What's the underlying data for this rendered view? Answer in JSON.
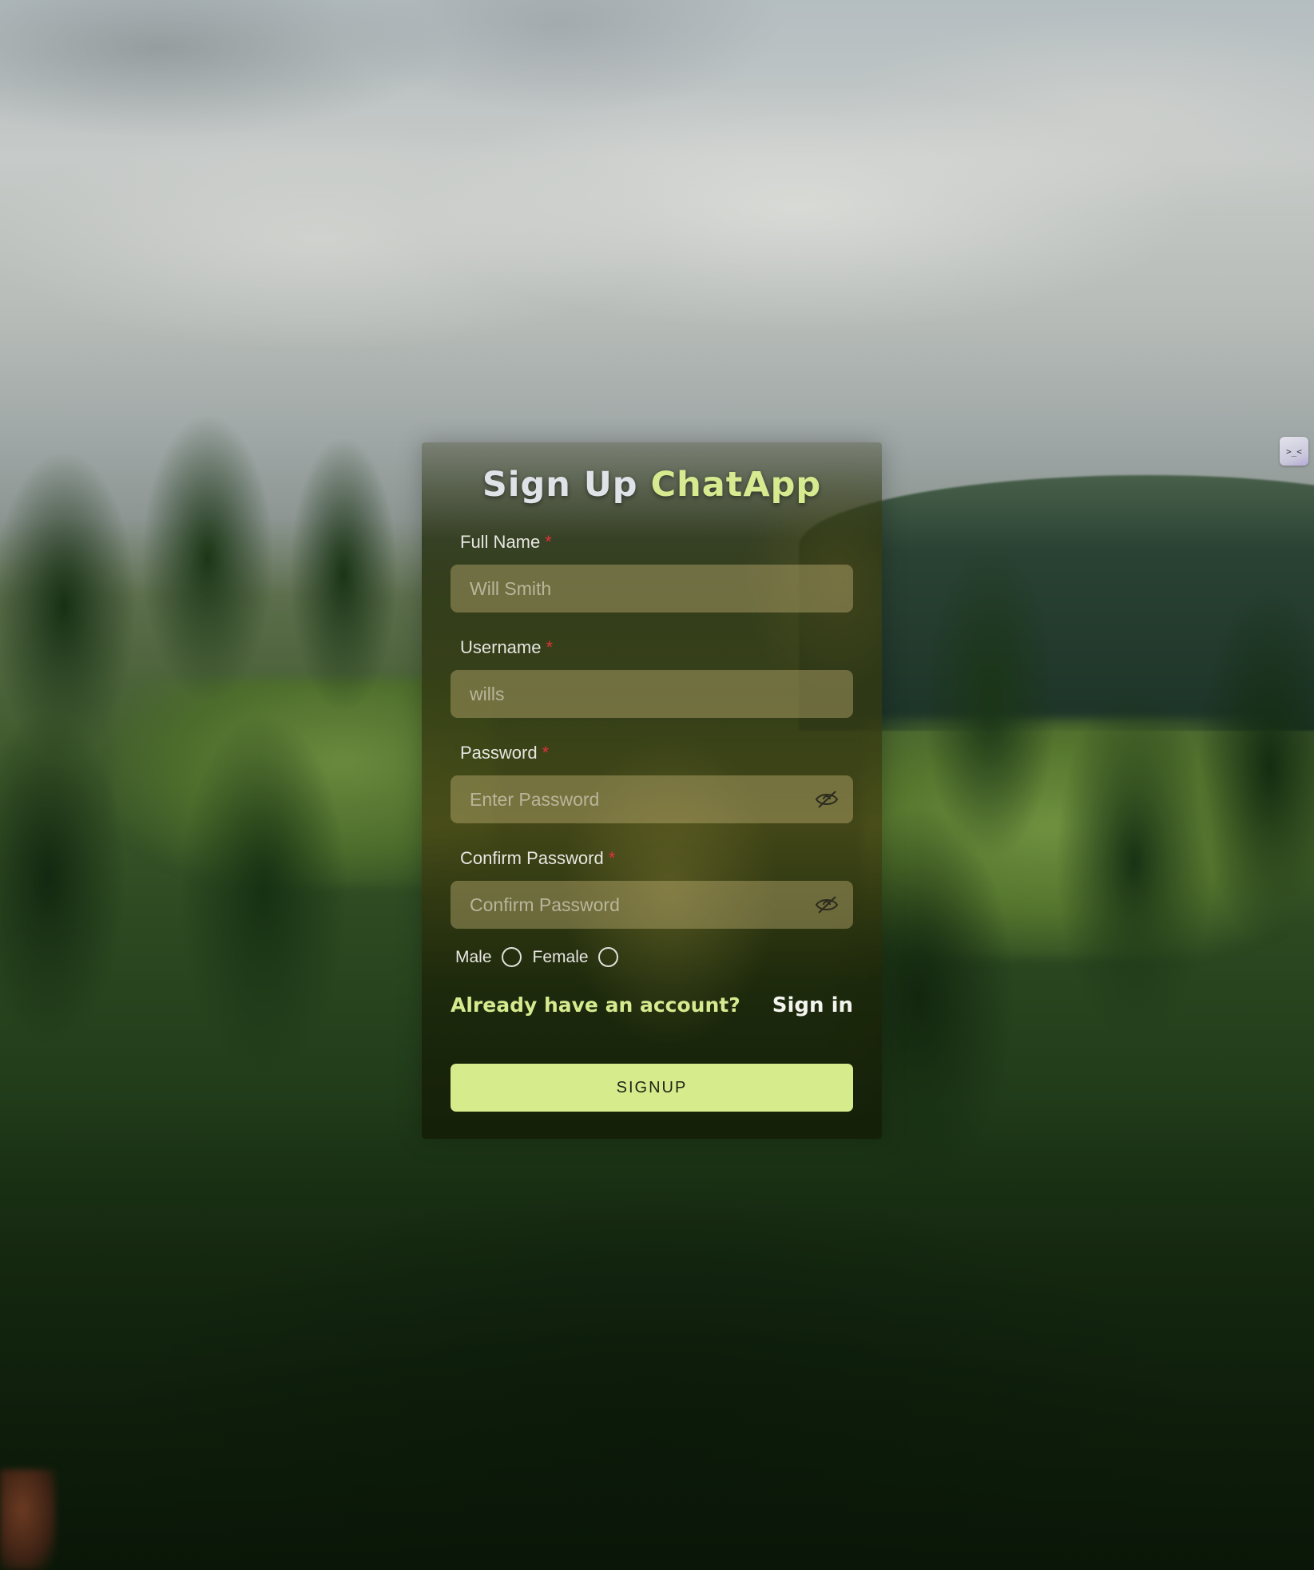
{
  "title": {
    "main": "Sign Up",
    "accent": "ChatApp"
  },
  "form": {
    "required_marker": "*",
    "full_name": {
      "label": "Full Name",
      "placeholder": "Will Smith"
    },
    "username": {
      "label": "Username",
      "placeholder": "wills"
    },
    "password": {
      "label": "Password",
      "placeholder": "Enter Password",
      "toggle_icon": "eye-off-icon"
    },
    "confirm_password": {
      "label": "Confirm Password",
      "placeholder": "Confirm Password",
      "toggle_icon": "eye-off-icon"
    },
    "gender": {
      "options": [
        "Male",
        "Female"
      ]
    }
  },
  "links": {
    "account_prompt": "Already have an account?",
    "sign_in": "Sign in"
  },
  "actions": {
    "signup": "SIGNUP"
  },
  "widget": {
    "icon": "terminal-icon",
    "glyph": ">_<"
  },
  "colors": {
    "accent": "#d6ea8f",
    "button": "#d5eb8c",
    "required": "#e0323a",
    "field_bg": "#c4b276"
  }
}
